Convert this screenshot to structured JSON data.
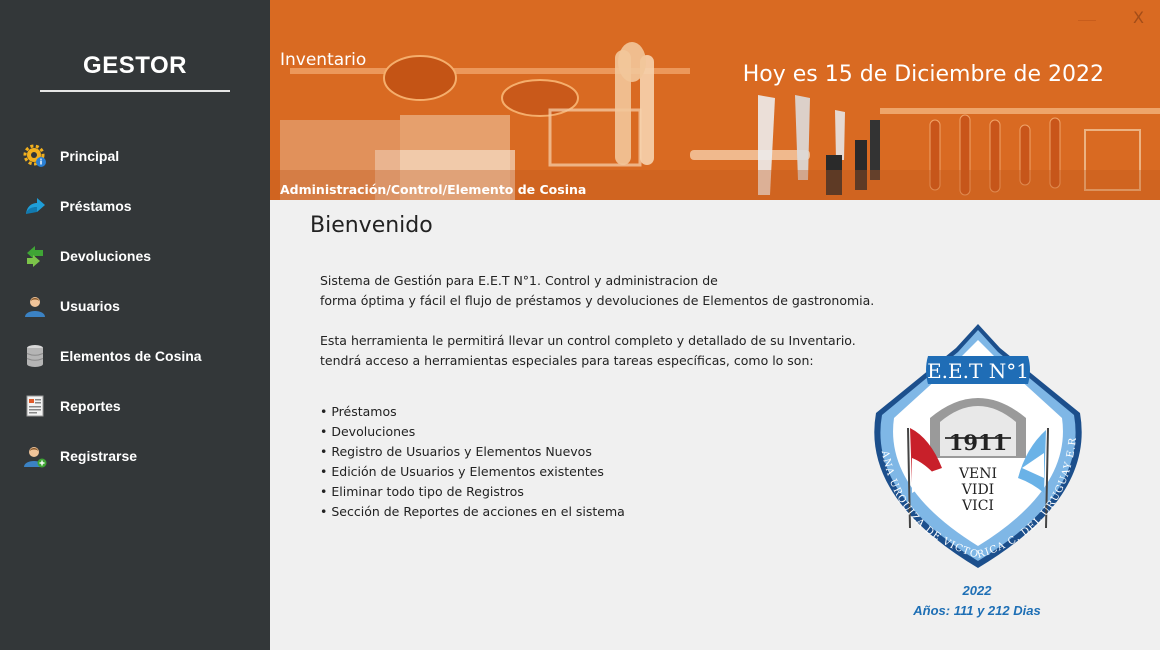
{
  "sidebar": {
    "brand": "GESTOR",
    "items": [
      {
        "label": "Principal",
        "icon": "gear-info-icon"
      },
      {
        "label": "Préstamos",
        "icon": "share-arrow-icon"
      },
      {
        "label": "Devoluciones",
        "icon": "return-arrows-icon"
      },
      {
        "label": "Usuarios",
        "icon": "user-icon"
      },
      {
        "label": "Elementos de Cosina",
        "icon": "database-icon"
      },
      {
        "label": "Reportes",
        "icon": "report-icon"
      },
      {
        "label": "Registrarse",
        "icon": "add-user-icon"
      }
    ]
  },
  "header": {
    "section": "Inventario",
    "date": "Hoy es 15 de Diciembre de 2022",
    "breadcrumb": "Administración/Control/Elemento de Cosina",
    "close_label": "X"
  },
  "main": {
    "welcome": "Bienvenido",
    "intro_line1": "Sistema de Gestión para E.E.T N°1. Control y administracion de",
    "intro_line2": "forma óptima y fácil el flujo de préstamos y devoluciones de Elementos de gastronomia.",
    "tool_line1": "Esta herramienta le permitirá llevar un control completo y detallado de su Inventario.",
    "tool_line2": "tendrá acceso a herramientas especiales para tareas específicas, como lo son:",
    "features": [
      "Préstamos",
      "Devoluciones",
      "Registro de Usuarios y Elementos Nuevos",
      "Edición de Usuarios y Elementos existentes",
      "Eliminar todo tipo de Registros",
      "Sección de Reportes de acciones en el sistema"
    ],
    "emblem": {
      "top": "E.E.T N°1",
      "year_founded": "1911",
      "motto1": "VENI",
      "motto2": "VIDI",
      "motto3": "VICI",
      "ring_text": "ANA URQUIZA DE VICTORICA C. DEL URUGUAY E.R."
    },
    "year": "2022",
    "age": "Años: 111 y 212 Dias"
  },
  "colors": {
    "sidebar_bg": "#333739",
    "header_bg": "#d96a22",
    "accent_blue": "#1e6fb5"
  }
}
